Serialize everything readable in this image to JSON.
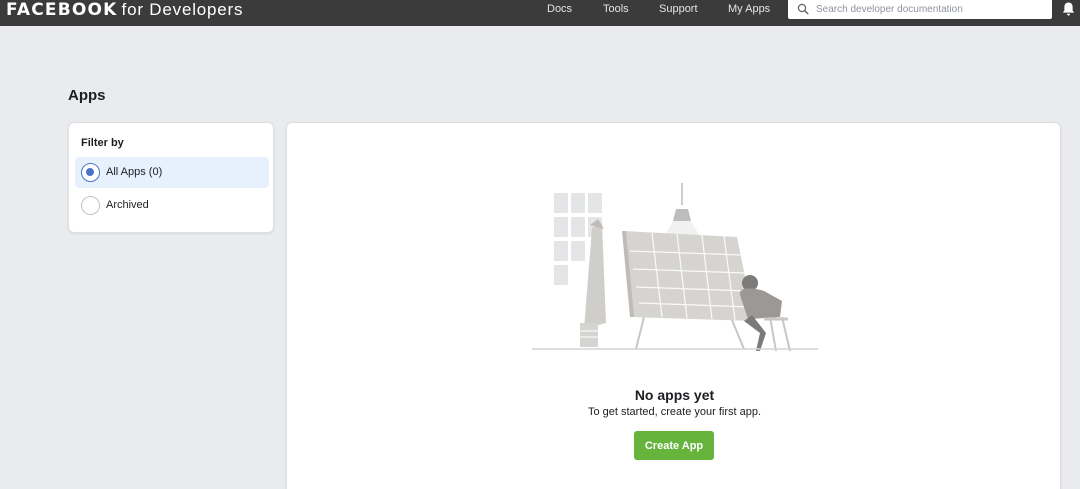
{
  "header": {
    "brand_main": "FACEBOOK",
    "brand_sub": "for Developers",
    "nav": [
      {
        "label": "Docs"
      },
      {
        "label": "Tools"
      },
      {
        "label": "Support"
      },
      {
        "label": "My Apps"
      }
    ],
    "search": {
      "placeholder": "Search developer documentation",
      "icon": "search-icon"
    },
    "notification_icon": "bell-icon"
  },
  "page": {
    "title": "Apps"
  },
  "filter": {
    "title": "Filter by",
    "options": [
      {
        "label": "All Apps (0)",
        "selected": true
      },
      {
        "label": "Archived",
        "selected": false
      }
    ]
  },
  "empty_state": {
    "title": "No apps yet",
    "subtitle": "To get started, create your first app.",
    "button_label": "Create App"
  },
  "colors": {
    "header_bg": "#3b3b3b",
    "page_bg": "#e9ebee",
    "accent_blue": "#4a75c6",
    "selected_bg": "#e7f0fd",
    "button_green": "#67b43c"
  }
}
